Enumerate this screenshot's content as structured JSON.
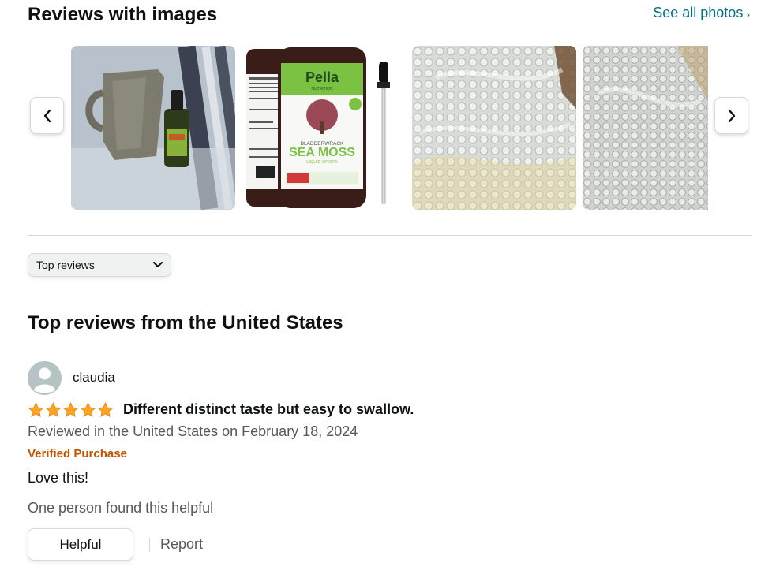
{
  "images_section": {
    "title": "Reviews with images",
    "see_all_label": "See all photos",
    "see_all_icon": "chevron-right-icon",
    "prev_icon": "chevron-left-icon",
    "next_icon": "chevron-right-icon",
    "thumbnails": [
      {
        "subject": "mug-and-dropper-bottle-photo"
      },
      {
        "subject": "product-bottle-photo",
        "brand": "Pella",
        "brand_sub": "NUTRITION",
        "product_top": "BLADDERWRACK",
        "product_name": "SEA MOSS",
        "product_sub": "LIQUID DROPS"
      },
      {
        "subject": "bubble-wrap-photo"
      },
      {
        "subject": "bubble-wrap-photo"
      }
    ]
  },
  "sort": {
    "selected": "Top reviews",
    "icon": "chevron-down-icon"
  },
  "reviews_section": {
    "title": "Top reviews from the United States"
  },
  "review": {
    "username": "claudia",
    "avatar_icon": "user-avatar-icon",
    "rating": 5,
    "star_color": "#ffa41c",
    "title": "Different distinct taste but easy to swallow.",
    "date": "Reviewed in the United States on February 18, 2024",
    "verified": "Verified Purchase",
    "body": "Love this!",
    "helpful_count": "One person found this helpful",
    "helpful_label": "Helpful",
    "report_label": "Report"
  },
  "colors": {
    "link": "#007185",
    "verified": "#c45500",
    "secondary_text": "#565959",
    "star": "#ffa41c"
  }
}
